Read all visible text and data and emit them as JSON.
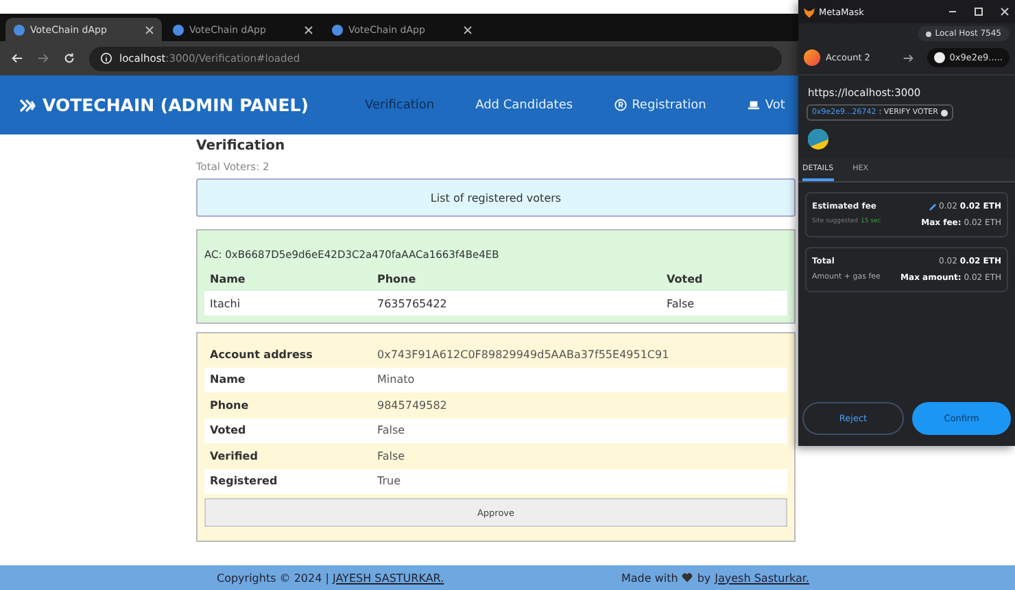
{
  "browser": {
    "tabs": [
      {
        "title": "VoteChain dApp",
        "selected": true
      },
      {
        "title": "VoteChain dApp",
        "selected": false
      },
      {
        "title": "VoteChain dApp",
        "selected": false
      }
    ],
    "url": {
      "host": "localhost",
      "path": ":3000/Verification#loaded"
    }
  },
  "navbar": {
    "brand": "VOTECHAIN (ADMIN PANEL)",
    "items": [
      {
        "label": "Verification",
        "selected": true,
        "kind": "plain"
      },
      {
        "label": "Add Candidates",
        "selected": false,
        "kind": "plain"
      },
      {
        "label": "Registration",
        "selected": false,
        "kind": "registered"
      },
      {
        "label": "Vot",
        "selected": false,
        "kind": "laptop"
      }
    ]
  },
  "page": {
    "title": "Verification",
    "total": "Total Voters: 2",
    "banner": "List of registered voters",
    "voters": [
      {
        "kind": "summary",
        "account": "AC: 0xB6687D5e9d6eE42D3C2a470faAACa1663f4Be4EB",
        "columns": [
          "Name",
          "Phone",
          "Voted"
        ],
        "values": [
          "Itachi",
          "7635765422",
          "False"
        ]
      },
      {
        "kind": "detail",
        "rows": [
          {
            "label": "Account address",
            "value": "0x743F91A612C0F89829949d5AABa37f55E4951C91"
          },
          {
            "label": "Name",
            "value": "Minato"
          },
          {
            "label": "Phone",
            "value": "9845749582"
          },
          {
            "label": "Voted",
            "value": "False"
          },
          {
            "label": "Verified",
            "value": "False"
          },
          {
            "label": "Registered",
            "value": "True"
          }
        ],
        "button": "Approve"
      }
    ]
  },
  "footer": {
    "left": "Copyrights © 2024 | ",
    "left_link": "JAYESH SASTURKAR.",
    "right": "Made with",
    "right_by": "by",
    "right_link": "Jayesh Sasturkar."
  },
  "metamask": {
    "title": "MetaMask",
    "network": "Local Host 7545",
    "account": "Account 2",
    "to": "0x9e2e9.....",
    "origin": "https://localhost:3000",
    "contract": "0x9e2e9...26742",
    "method": ": VERIFY VOTER",
    "tabs": [
      {
        "label": "DETAILS",
        "selected": true
      },
      {
        "label": "HEX",
        "selected": false
      }
    ],
    "fee": {
      "label": "Estimated fee",
      "hint": "Site suggested",
      "time": "15 sec",
      "amount": "0.02",
      "amount_bold": "0.02 ETH",
      "max_label": "Max fee:",
      "max": "0.02 ETH"
    },
    "total": {
      "label": "Total",
      "hint": "Amount + gas fee",
      "amount": "0.02",
      "amount_bold": "0.02 ETH",
      "max_label": "Max amount:",
      "max": "0.02 ETH"
    },
    "reject": "Reject",
    "confirm": "Confirm"
  }
}
